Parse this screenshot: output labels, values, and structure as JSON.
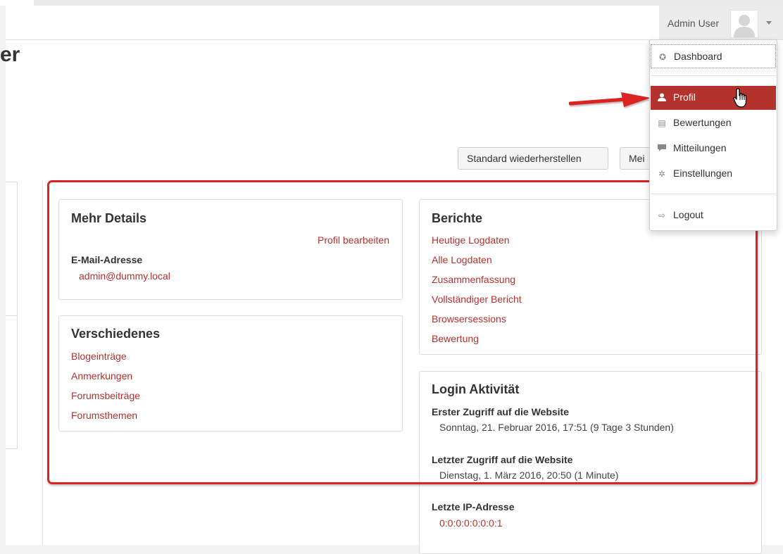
{
  "navbar": {
    "user_name": "Admin User"
  },
  "page": {
    "title_fragment": "er"
  },
  "buttons": {
    "reset": "Standard wiederherstellen",
    "my_page_partial": "Mei"
  },
  "dropdown": {
    "items": [
      {
        "label": "Dashboard",
        "icon": "dashboard-icon"
      },
      {
        "label": "Profil",
        "icon": "user-icon"
      },
      {
        "label": "Bewertungen",
        "icon": "grades-table-icon"
      },
      {
        "label": "Mitteilungen",
        "icon": "message-bubble-icon"
      },
      {
        "label": "Einstellungen",
        "icon": "gear-icon"
      },
      {
        "label": "Logout",
        "icon": "logout-icon"
      }
    ]
  },
  "details": {
    "title": "Mehr Details",
    "edit_link": "Profil bearbeiten",
    "email_label": "E-Mail-Adresse",
    "email_value": "admin@dummy.local"
  },
  "misc": {
    "title": "Verschiedenes",
    "links": [
      "Blogeinträge",
      "Anmerkungen",
      "Forumsbeiträge",
      "Forumsthemen"
    ]
  },
  "reports": {
    "title": "Berichte",
    "links": [
      "Heutige Logdaten",
      "Alle Logdaten",
      "Zusammenfassung",
      "Vollständiger Bericht",
      "Browsersessions",
      "Bewertung"
    ]
  },
  "login": {
    "title": "Login Aktivität",
    "first_label": "Erster Zugriff auf die Website",
    "first_value": "Sonntag, 21. Februar 2016, 17:51  (9 Tage 3 Stunden)",
    "last_label": "Letzter Zugriff auf die Website",
    "last_value": "Dienstag, 1. März 2016, 20:50  (1 Minute)",
    "ip_label": "Letzte IP-Adresse",
    "ip_value": "0:0:0:0:0:0:0:1"
  },
  "colors": {
    "accent": "#b3322e",
    "highlight": "#dd2222"
  }
}
